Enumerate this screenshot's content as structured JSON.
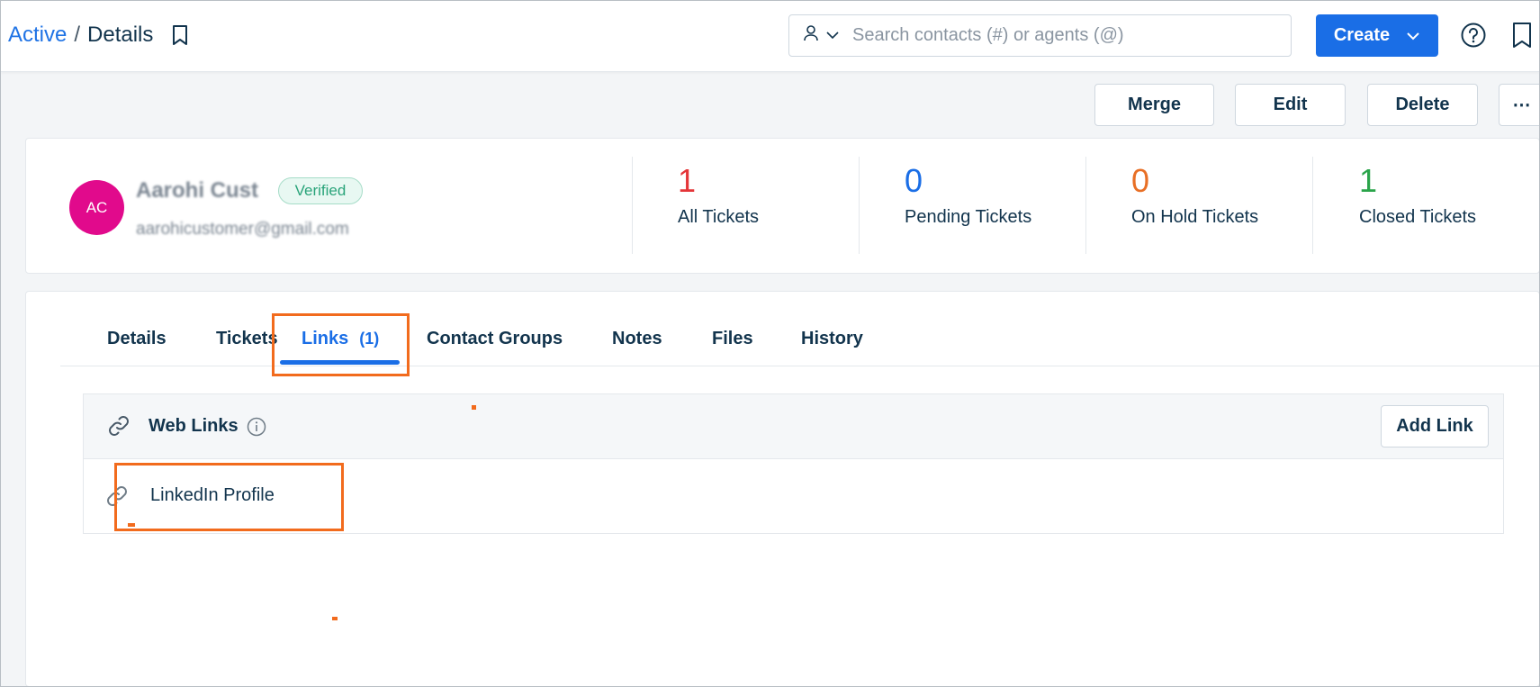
{
  "header": {
    "breadcrumb_parent": "Active",
    "breadcrumb_separator": "/",
    "breadcrumb_current": "Details",
    "search_placeholder": "Search contacts (#) or agents (@)",
    "create_label": "Create"
  },
  "actions": {
    "merge": "Merge",
    "edit": "Edit",
    "delete": "Delete",
    "more": "⋯"
  },
  "contact": {
    "initials": "AC",
    "name": "Aarohi Cust",
    "status_badge": "Verified",
    "email": "aarohicustomer@gmail.com",
    "avatar_color": "#e10a8c"
  },
  "stats": [
    {
      "value": "1",
      "label": "All Tickets",
      "color": "#e43538"
    },
    {
      "value": "0",
      "label": "Pending Tickets",
      "color": "#1a6ee6"
    },
    {
      "value": "0",
      "label": "On Hold Tickets",
      "color": "#e86f25"
    },
    {
      "value": "1",
      "label": "Closed Tickets",
      "color": "#2aa44a"
    }
  ],
  "tabs": [
    {
      "label": "Details"
    },
    {
      "label": "Tickets"
    },
    {
      "label": "Links",
      "count": "(1)"
    },
    {
      "label": "Contact Groups"
    },
    {
      "label": "Notes"
    },
    {
      "label": "Files"
    },
    {
      "label": "History"
    }
  ],
  "web_links": {
    "title": "Web Links",
    "add_label": "Add Link",
    "items": [
      {
        "label": "LinkedIn Profile"
      }
    ]
  },
  "colors": {
    "accent": "#1a6ee6",
    "highlight": "#f26b1d"
  }
}
